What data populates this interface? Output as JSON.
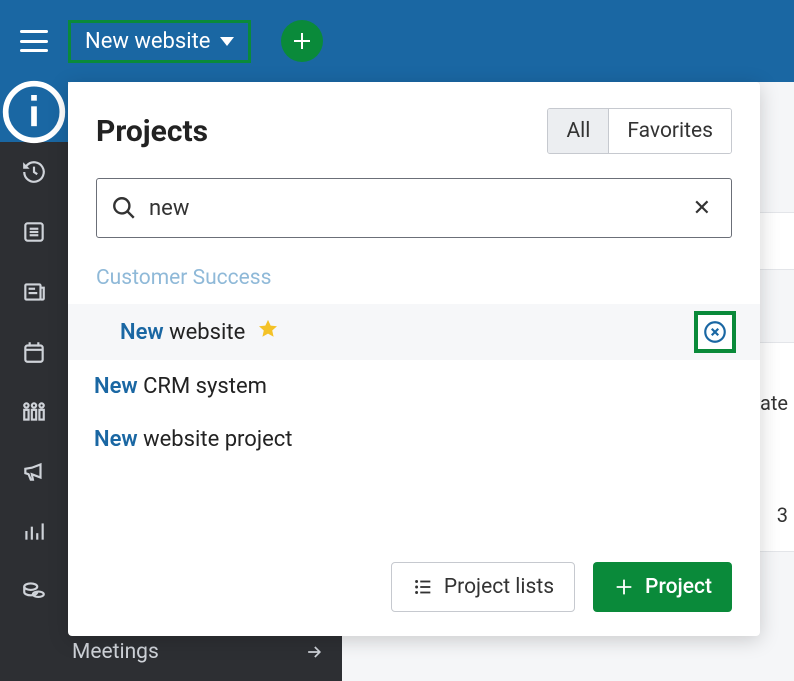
{
  "topbar": {
    "current_project": "New website"
  },
  "sidebar": {
    "expanded_item_label": "Meetings"
  },
  "main_peek": {
    "text1": "ate",
    "text2": "3"
  },
  "popover": {
    "title": "Projects",
    "tabs": {
      "all": "All",
      "favorites": "Favorites"
    },
    "search_value": "new",
    "group_label": "Customer Success",
    "results": [
      {
        "match": "New",
        "rest": " website",
        "favorite": true
      },
      {
        "match": "New",
        "rest": " CRM system",
        "favorite": false
      },
      {
        "match": "New",
        "rest": " website project",
        "favorite": false
      }
    ],
    "footer": {
      "lists_label": "Project lists",
      "create_label": "Project"
    }
  }
}
